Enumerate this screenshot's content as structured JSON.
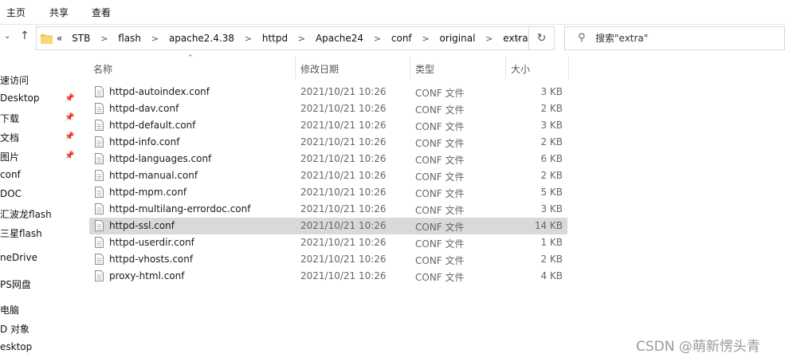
{
  "ribbon": {
    "tabs": [
      "主页",
      "共享",
      "查看"
    ]
  },
  "address_bar": {
    "crumbs": [
      "«",
      "STB",
      "flash",
      "apache2.4.38",
      "httpd",
      "Apache24",
      "conf",
      "original",
      "extra"
    ]
  },
  "search": {
    "placeholder": "搜索\"extra\""
  },
  "sidebar": {
    "items": [
      {
        "label": "速访问",
        "pinned": false
      },
      {
        "label": "Desktop",
        "pinned": true
      },
      {
        "label": "下载",
        "pinned": true
      },
      {
        "label": "文档",
        "pinned": true
      },
      {
        "label": "图片",
        "pinned": true
      },
      {
        "label": "conf",
        "pinned": false
      },
      {
        "label": "DOC",
        "pinned": false
      },
      {
        "label": "汇波龙flash",
        "pinned": false
      },
      {
        "label": "三星flash",
        "pinned": false
      },
      {
        "label": "neDrive",
        "pinned": false
      },
      {
        "label": "PS网盘",
        "pinned": false
      },
      {
        "label": "电脑",
        "pinned": false
      },
      {
        "label": "D 对象",
        "pinned": false
      },
      {
        "label": "esktop",
        "pinned": false
      }
    ]
  },
  "columns": {
    "name": "名称",
    "modified": "修改日期",
    "type": "类型",
    "size": "大小"
  },
  "files": [
    {
      "name": "httpd-autoindex.conf",
      "date": "2021/10/21 10:26",
      "type": "CONF 文件",
      "size": "3 KB",
      "selected": false
    },
    {
      "name": "httpd-dav.conf",
      "date": "2021/10/21 10:26",
      "type": "CONF 文件",
      "size": "2 KB",
      "selected": false
    },
    {
      "name": "httpd-default.conf",
      "date": "2021/10/21 10:26",
      "type": "CONF 文件",
      "size": "3 KB",
      "selected": false
    },
    {
      "name": "httpd-info.conf",
      "date": "2021/10/21 10:26",
      "type": "CONF 文件",
      "size": "2 KB",
      "selected": false
    },
    {
      "name": "httpd-languages.conf",
      "date": "2021/10/21 10:26",
      "type": "CONF 文件",
      "size": "6 KB",
      "selected": false
    },
    {
      "name": "httpd-manual.conf",
      "date": "2021/10/21 10:26",
      "type": "CONF 文件",
      "size": "2 KB",
      "selected": false
    },
    {
      "name": "httpd-mpm.conf",
      "date": "2021/10/21 10:26",
      "type": "CONF 文件",
      "size": "5 KB",
      "selected": false
    },
    {
      "name": "httpd-multilang-errordoc.conf",
      "date": "2021/10/21 10:26",
      "type": "CONF 文件",
      "size": "3 KB",
      "selected": false
    },
    {
      "name": "httpd-ssl.conf",
      "date": "2021/10/21 10:26",
      "type": "CONF 文件",
      "size": "14 KB",
      "selected": true
    },
    {
      "name": "httpd-userdir.conf",
      "date": "2021/10/21 10:26",
      "type": "CONF 文件",
      "size": "1 KB",
      "selected": false
    },
    {
      "name": "httpd-vhosts.conf",
      "date": "2021/10/21 10:26",
      "type": "CONF 文件",
      "size": "2 KB",
      "selected": false
    },
    {
      "name": "proxy-html.conf",
      "date": "2021/10/21 10:26",
      "type": "CONF 文件",
      "size": "4 KB",
      "selected": false
    }
  ],
  "watermark": "CSDN @萌新愣头青"
}
